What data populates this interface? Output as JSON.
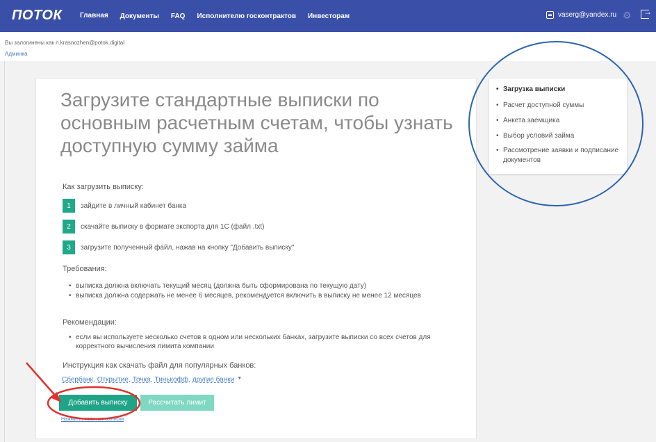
{
  "header": {
    "logo": "ПОТОК",
    "nav": [
      "Главная",
      "Документы",
      "FAQ",
      "Исполнителю госконтрактов",
      "Инвесторам"
    ],
    "user_email": "vaserg@yandex.ru"
  },
  "subheader": {
    "login_note": "Вы залогинены как n.krasnozhen@potok.digital",
    "admin_link": "Админка"
  },
  "main": {
    "headline": "Загрузите стандартные выписки по основным расчетным счетам, чтобы узнать доступную сумму займа",
    "how_title": "Как загрузить выписку:",
    "steps": [
      {
        "num": "1",
        "text": "зайдите в личный кабинет банка"
      },
      {
        "num": "2",
        "text": "скачайте выписку в формате экспорта для 1С (файл .txt)"
      },
      {
        "num": "3",
        "text": "загрузите полученный файл, нажав на кнопку \"Добавить выписку\""
      }
    ],
    "requirements_title": "Требования:",
    "requirements": [
      "выписка должна включать текущий месяц (должна быть сформирована по текущую дату)",
      "выписка должна содержать не менее 6 месяцев, рекомендуется включить в выписку не менее 12 месяцев"
    ],
    "recommendations_title": "Рекомендации:",
    "recommendations": [
      "если вы используете несколько счетов в одном или нескольких банках, загрузите выписки со всех счетов для корректного вычисления лимита компании"
    ],
    "instructions_title": "Инструкция как скачать файл для популярных банков:",
    "banks": [
      "Сбербанк",
      "Открытие",
      "Точка",
      "Тинькофф",
      "другие банки"
    ],
    "add_button": "Добавить выписку",
    "calc_button": "Рассчитать лимит",
    "no_statement_link": "Нажмите, если нет выписки"
  },
  "sidebar": {
    "items": [
      {
        "label": "Загрузка выписки",
        "active": true
      },
      {
        "label": "Расчет доступной суммы",
        "active": false
      },
      {
        "label": "Анкета заемщика",
        "active": false
      },
      {
        "label": "Выбор условий займа",
        "active": false
      },
      {
        "label": "Рассмотрение заявки и подписание документов",
        "active": false
      }
    ]
  },
  "colors": {
    "header_bg": "#3a50a8",
    "primary_button": "#1fa487",
    "secondary_button": "#7ed8c2",
    "annotation_circle": "#2a64b0",
    "annotation_arrow": "#e0322c"
  }
}
